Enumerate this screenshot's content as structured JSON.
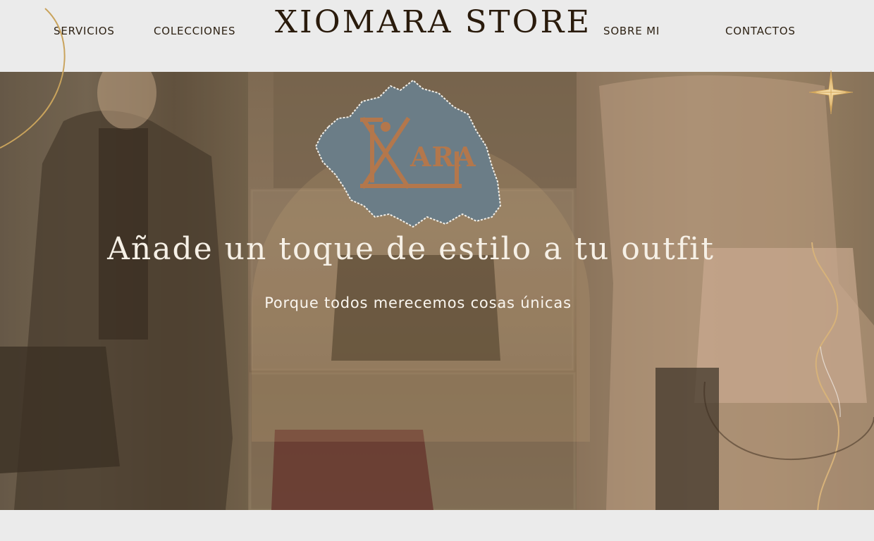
{
  "nav": {
    "servicios": "SERVICIOS",
    "colecciones": "COLECCIONES",
    "sobre_mi": "SOBRE MI",
    "contactos": "CONTACTOS"
  },
  "brand": {
    "title": "XIOMARA STORE"
  },
  "logo": {
    "text": "ARA",
    "icon": "xiomara-monogram-icon"
  },
  "hero": {
    "title": "Añade un toque de estilo a tu outfit",
    "subtitle": "Porque todos merecemos cosas únicas"
  },
  "colors": {
    "background": "#ebebeb",
    "text_dark": "#2a1b0c",
    "gold_accent": "#c9a35c",
    "logo_blue": "#6b7d87",
    "logo_copper": "#b3774c"
  }
}
